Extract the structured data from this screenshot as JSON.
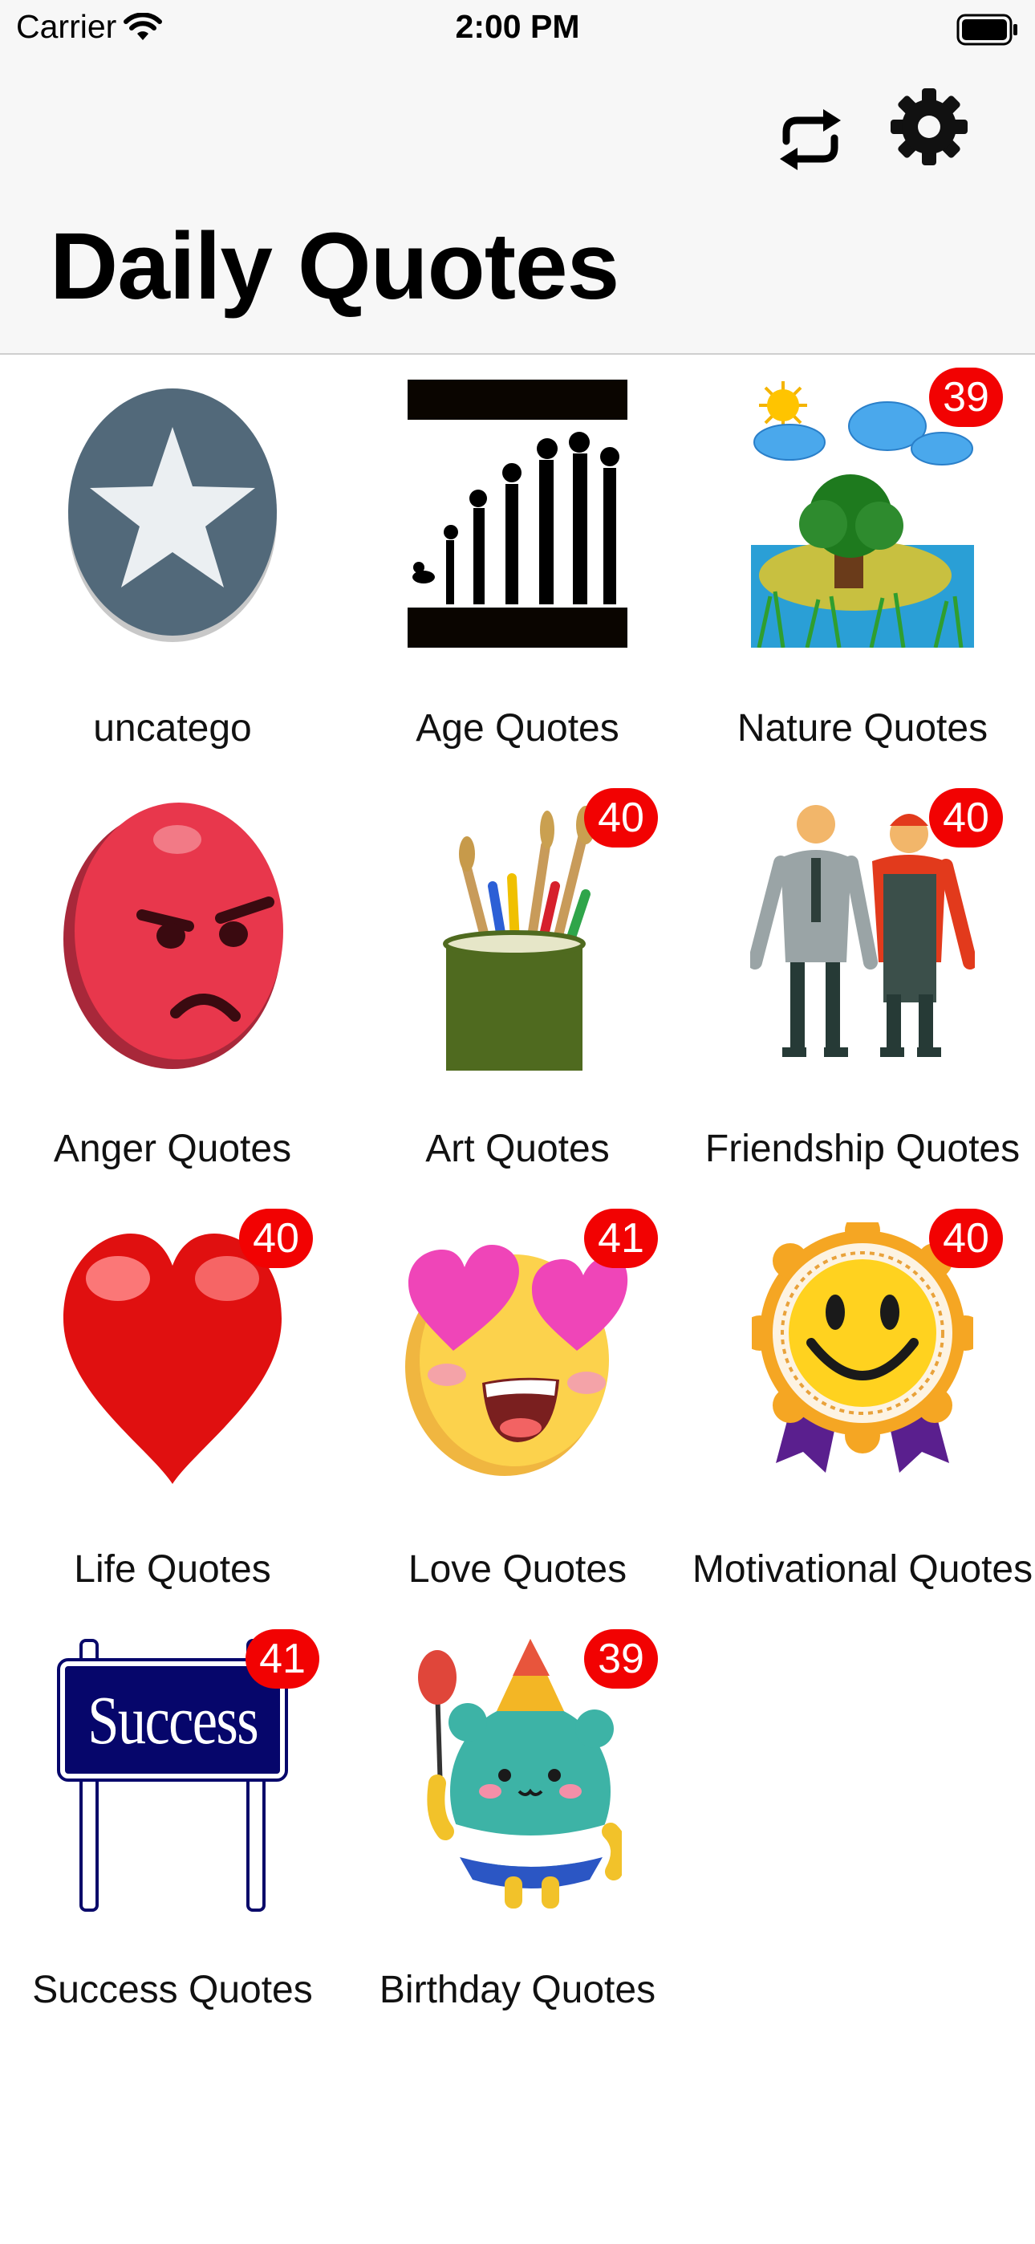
{
  "status_bar": {
    "carrier": "Carrier",
    "time": "2:00 PM"
  },
  "header": {
    "title": "Daily Quotes",
    "refresh_icon": "refresh-icon",
    "settings_icon": "gear-icon"
  },
  "colors": {
    "badge": "#f20202",
    "header_bg": "#f7f7f7"
  },
  "categories": [
    {
      "label": "uncatego",
      "badge": "",
      "icon": "star-circle-icon"
    },
    {
      "label": "Age Quotes",
      "badge": "",
      "icon": "evolution-image"
    },
    {
      "label": "Nature Quotes",
      "badge": "39",
      "icon": "nature-image"
    },
    {
      "label": "Anger Quotes",
      "badge": "",
      "icon": "angry-face-icon"
    },
    {
      "label": "Art Quotes",
      "badge": "40",
      "icon": "brushes-cup-image"
    },
    {
      "label": "Friendship Quotes",
      "badge": "40",
      "icon": "friends-image"
    },
    {
      "label": "Life Quotes",
      "badge": "40",
      "icon": "heart-icon"
    },
    {
      "label": "Love Quotes",
      "badge": "41",
      "icon": "heart-eyes-emoji"
    },
    {
      "label": "Motivational Quotes",
      "badge": "40",
      "icon": "smile-medal-icon"
    },
    {
      "label": "Success Quotes",
      "badge": "41",
      "icon": "success-sign-image"
    },
    {
      "label": "Birthday Quotes",
      "badge": "39",
      "icon": "birthday-character-image"
    }
  ],
  "success_sign_text": "Success"
}
